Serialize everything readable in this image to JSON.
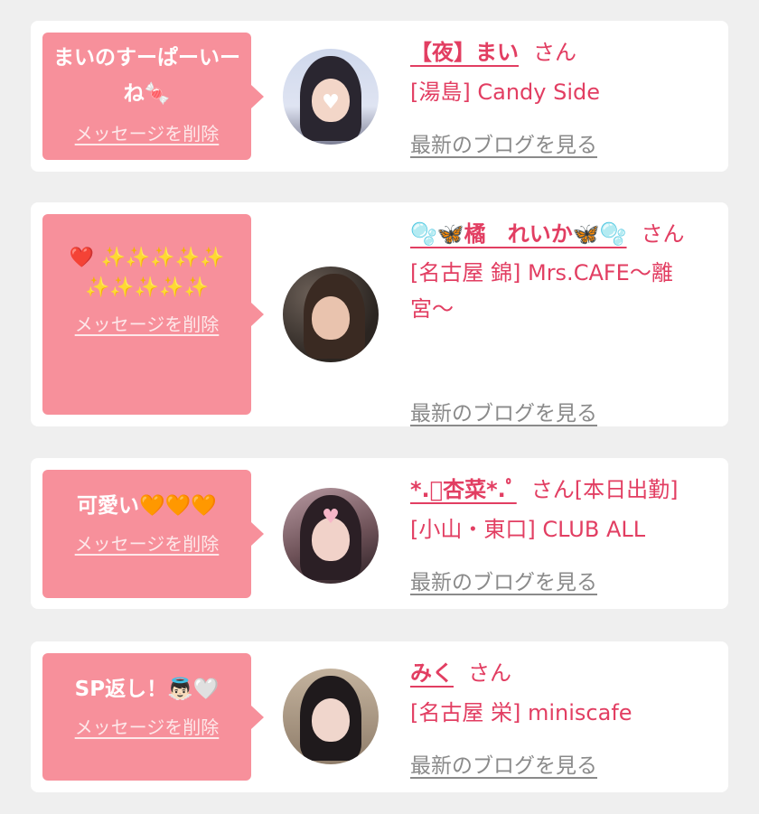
{
  "entries": [
    {
      "message": "まいのすーぱーいーね🍬",
      "delete_label": "メッセージを削除",
      "name": "【夜】まい",
      "suffix": "さん",
      "shop": "[湯島] Candy Side",
      "blog_label": "最新のブログを見る"
    },
    {
      "message": "❤️ ✨✨✨✨✨✨✨✨✨✨",
      "delete_label": "メッセージを削除",
      "name": "🫧🦋橘　れいか🦋🫧",
      "suffix": "さん",
      "shop": "[名古屋 錦] Mrs.CAFE〜離宮〜",
      "blog_label": "最新のブログを見る"
    },
    {
      "message": "可愛い🧡🧡🧡",
      "delete_label": "メッセージを削除",
      "name": "*.ﾟ杏菜*.ﾟ",
      "suffix": "さん[本日出勤]",
      "shop": "[小山・東口] CLUB ALL",
      "blog_label": "最新のブログを見る"
    },
    {
      "message": "SP返し！👼🏻🤍",
      "delete_label": "メッセージを削除",
      "name": "みく",
      "suffix": "さん",
      "shop": "[名古屋 栄] miniscafe",
      "blog_label": "最新のブログを見る"
    }
  ],
  "colors": {
    "bubble": "#f7909b",
    "accent_text": "#e23e62",
    "link_gray": "#8a8a8a",
    "background": "#efefef"
  }
}
